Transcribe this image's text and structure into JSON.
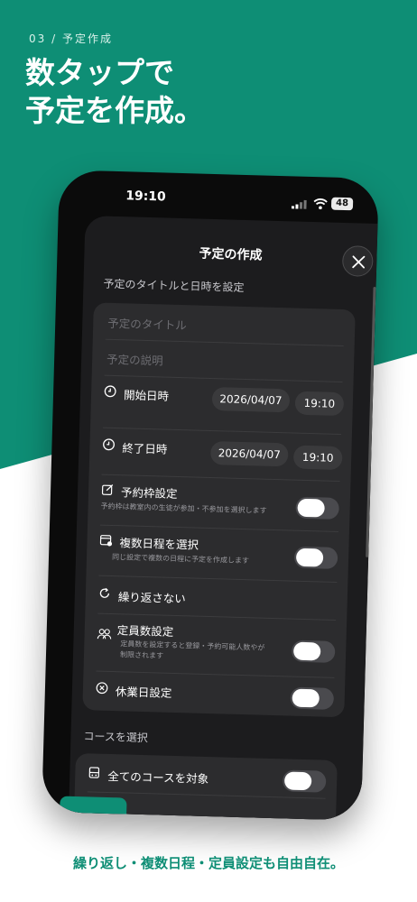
{
  "colors": {
    "brand": "#0e8e75",
    "sheet": "#1c1c1e",
    "card": "#2c2c2e"
  },
  "promo": {
    "step": "03 / 予定作成",
    "headline_line1": "数タップで",
    "headline_line2": "予定を作成。",
    "caption": "繰り返し・複数日程・定員設定も自由自在。"
  },
  "status_bar": {
    "time": "19:10",
    "battery": "48"
  },
  "sheet": {
    "title": "予定の作成",
    "section_title_label": "予定のタイトルと日時を設定",
    "title_placeholder": "予定のタイトル",
    "description_placeholder": "予定の説明",
    "start": {
      "label": "開始日時",
      "date": "2026/04/07",
      "time": "19:10"
    },
    "end": {
      "label": "終了日時",
      "date": "2026/04/07",
      "time": "19:10"
    },
    "reservation": {
      "label": "予約枠設定",
      "sub": "予約枠は教室内の生徒が参加・不参加を選択します"
    },
    "multiple": {
      "label": "複数日程を選択",
      "sub": "同じ設定で複数の日程に予定を作成します"
    },
    "repeat": {
      "label": "繰り返さない"
    },
    "capacity": {
      "label": "定員数設定",
      "sub1": "定員数を設定すると登録・予約可能人数やが",
      "sub2": "制限されます"
    },
    "holiday": {
      "label": "休業日設定"
    },
    "course_section_label": "コースを選択",
    "all_courses": {
      "label": "全てのコースを対象"
    }
  },
  "icons": [
    "clock-icon",
    "clock-icon",
    "edit-icon",
    "calendar-plus-icon",
    "repeat-icon",
    "users-icon",
    "x-circle-icon",
    "course-icon",
    "close-icon",
    "signal-icon",
    "wifi-icon"
  ]
}
